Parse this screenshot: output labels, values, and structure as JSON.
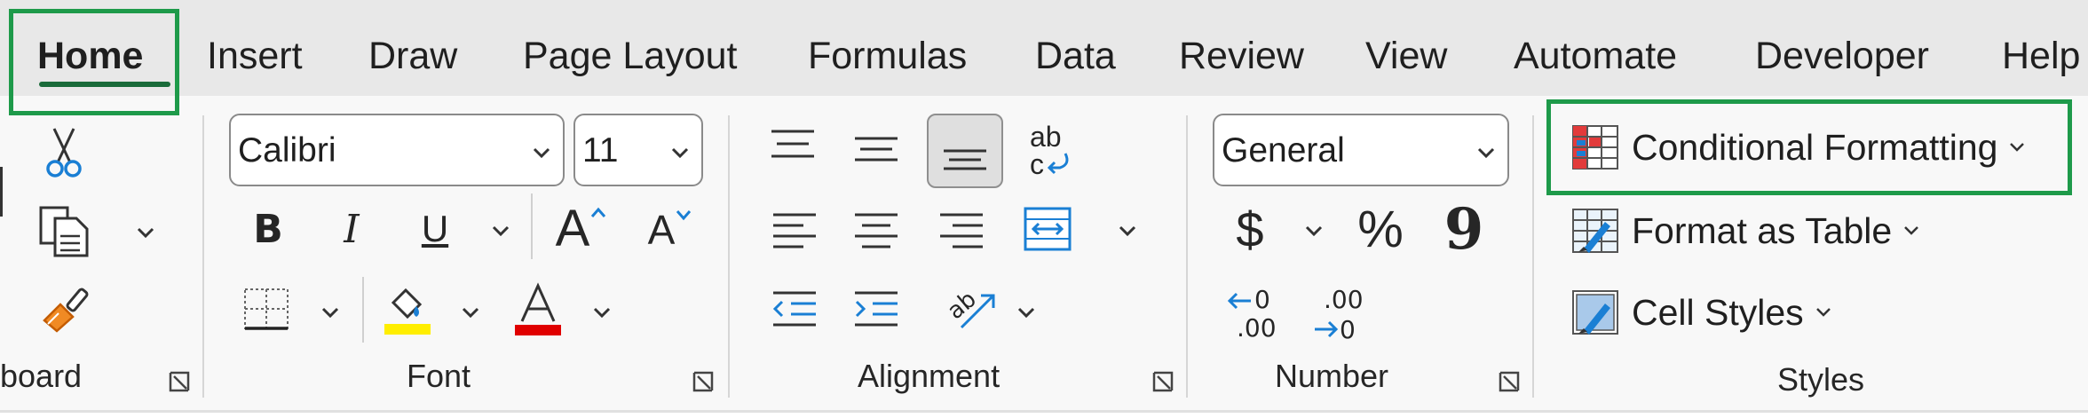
{
  "tabs": [
    {
      "label": "Home",
      "active": true
    },
    {
      "label": "Insert"
    },
    {
      "label": "Draw"
    },
    {
      "label": "Page Layout"
    },
    {
      "label": "Formulas"
    },
    {
      "label": "Data"
    },
    {
      "label": "Review"
    },
    {
      "label": "View"
    },
    {
      "label": "Automate"
    },
    {
      "label": "Developer"
    },
    {
      "label": "Help"
    }
  ],
  "groups": {
    "clipboard": {
      "label": "board"
    },
    "font": {
      "label": "Font",
      "font_name": "Calibri",
      "font_size": "11",
      "bold": "B",
      "italic": "I",
      "underline": "U",
      "grow": "A",
      "shrink": "A"
    },
    "alignment": {
      "label": "Alignment",
      "wrap_glyph_top": "ab",
      "wrap_glyph_bottom": "c"
    },
    "number": {
      "label": "Number",
      "format": "General",
      "currency": "$",
      "percent": "%",
      "comma": "9",
      "inc_top": "0",
      "inc_bottom": ".00",
      "dec_top": ".00",
      "dec_bottom": "0"
    },
    "styles": {
      "label": "Styles",
      "conditional_formatting": "Conditional Formatting",
      "format_as_table": "Format as Table",
      "cell_styles": "Cell Styles"
    }
  },
  "colors": {
    "highlight_accent": "#1e9a4a",
    "fill_color": "#ffee00",
    "font_color": "#e00000",
    "icon_blue": "#1a7fd4"
  }
}
